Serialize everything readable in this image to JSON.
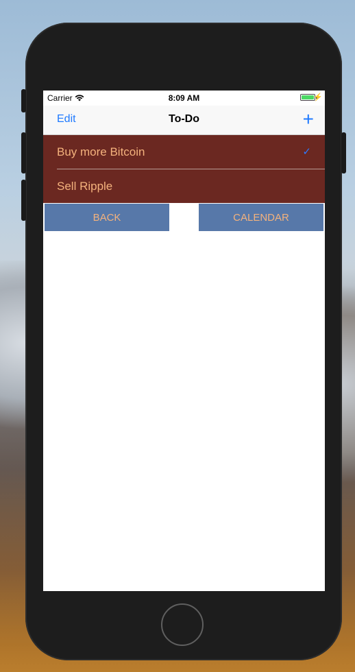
{
  "status_bar": {
    "carrier": "Carrier",
    "time": "8:09 AM"
  },
  "nav": {
    "edit_label": "Edit",
    "title": "To-Do",
    "add_symbol": "+"
  },
  "todos": [
    {
      "label": "Buy more Bitcoin",
      "checked": true
    },
    {
      "label": "Sell Ripple",
      "checked": false
    }
  ],
  "buttons": {
    "back_label": "BACK",
    "calendar_label": "CALENDAR"
  },
  "colors": {
    "tint": "#1f7aff",
    "row_bg": "#6b2821",
    "row_text": "#f4b27d",
    "button_bg": "#5778a9"
  }
}
